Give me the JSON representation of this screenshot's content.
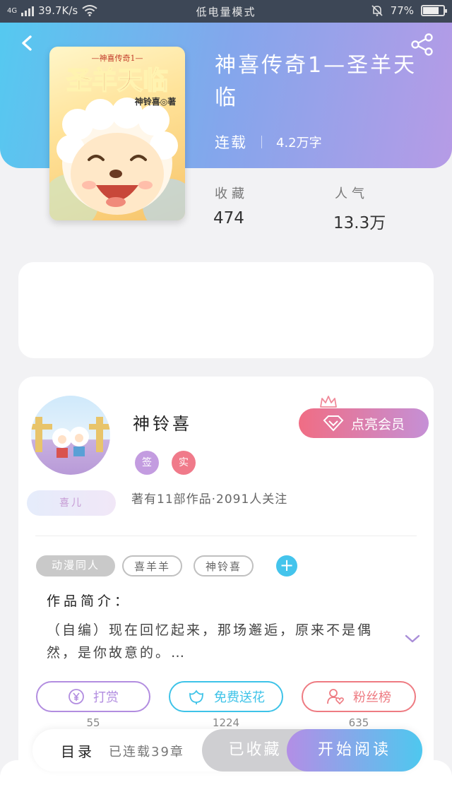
{
  "status_bar": {
    "network": "4G",
    "speed": "39.7K/s",
    "mode": "低电量模式",
    "battery": "77%",
    "battery_level": 0.77
  },
  "book": {
    "title": "神喜传奇1—圣羊天临",
    "serial_status": "连载",
    "word_count": "4.2万字",
    "cover": {
      "series_label": "—神喜传奇1—",
      "title_art": "圣羊天临",
      "author_art": "神铃喜◎著"
    },
    "stats": [
      {
        "label": "收藏",
        "value": "474"
      },
      {
        "label": "人气",
        "value": "13.3万"
      }
    ]
  },
  "author": {
    "name": "神铃喜",
    "badges": [
      {
        "text": "签",
        "color": "#c39ce0"
      },
      {
        "text": "实",
        "color": "#f07a8a"
      }
    ],
    "fan_badge": "喜儿",
    "meta": "著有11部作品·2091人关注",
    "vip_button": "点亮会员"
  },
  "tags": [
    {
      "text": "动漫同人",
      "style": "filled"
    },
    {
      "text": "喜羊羊",
      "style": "outline"
    },
    {
      "text": "神铃喜",
      "style": "outline"
    }
  ],
  "intro": {
    "title": "作品简介：",
    "text": "（自编）现在回忆起来，那场邂逅，原来不是偶然，是你故意的。…"
  },
  "actions": [
    {
      "label": "打赏",
      "count": "55",
      "color": "#b28de0"
    },
    {
      "label": "免费送花",
      "count": "1224",
      "color": "#3ec3e8"
    },
    {
      "label": "粉丝榜",
      "count": "635",
      "color": "#ee7b82"
    }
  ],
  "bottom_bar": {
    "catalog": "目录",
    "chapters": "已连载39章",
    "collected": "已收藏",
    "read": "开始阅读"
  },
  "colors": {
    "header_gradient": [
      "#55c9f0",
      "#b69be6"
    ],
    "read_gradient": [
      "#b38ee6",
      "#4ec8ef"
    ]
  }
}
